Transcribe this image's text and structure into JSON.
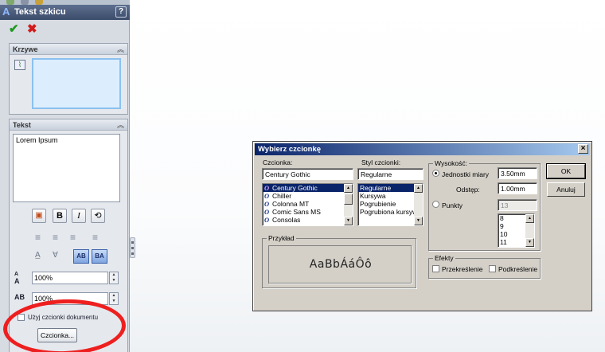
{
  "panel": {
    "title": "Tekst szkicu",
    "help_label": "?",
    "curves_group": {
      "title": "Krzywe"
    },
    "text_group": {
      "title": "Tekst",
      "text_value": "Lorem Ipsum",
      "bold_label": "B",
      "italic_label": "I",
      "vertical_btn_label": "AB",
      "reverse_btn_label": "BA",
      "width_factor": "100%",
      "spacing_factor": "100%",
      "width_label_top": "A",
      "width_label_bottom": "A",
      "spacing_label": "AB",
      "use_doc_font_label": "Użyj czcionki dokumentu",
      "font_button_label": "Czcionka..."
    }
  },
  "dialog": {
    "title": "Wybierz czcionkę",
    "close_label": "×",
    "font_label": "Czcionka:",
    "font_value": "Century Gothic",
    "fonts": [
      "Century Gothic",
      "Chiller",
      "Colonna MT",
      "Comic Sans MS",
      "Consolas"
    ],
    "style_label": "Styl czcionki:",
    "style_value": "Regularne",
    "styles": [
      "Regularne",
      "Kursywa",
      "Pogrubienie",
      "Pogrubiona kursywa"
    ],
    "height_group": "Wysokość:",
    "units_label": "Jednostki miary",
    "units_value": "3.50mm",
    "spacing_label": "Odstęp:",
    "spacing_value": "1.00mm",
    "points_label": "Punkty",
    "points_value": "13",
    "point_sizes": [
      "8",
      "9",
      "10",
      "11"
    ],
    "ok_label": "OK",
    "cancel_label": "Anuluj",
    "sample_group": "Przykład",
    "sample_text": "AaBbÁáÔô",
    "effects_group": "Efekty",
    "strike_label": "Przekreślenie",
    "underline_label": "Podkreślenie"
  },
  "colors": {
    "annotation": "#ee1f1f",
    "selection": "#0a246a",
    "ok_check": "#1d9a1d",
    "cancel_x": "#d21b1b"
  }
}
